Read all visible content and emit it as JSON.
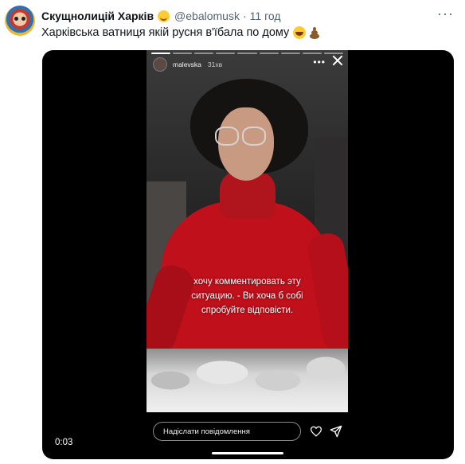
{
  "tweet": {
    "author_name": "Скущнолицій Харків",
    "handle": "@ebalomusk",
    "separator": "·",
    "time": "11 год",
    "text": "Харківська ватниця якій русня в'їбала по дому",
    "more_icon": "more-horizontal-icon",
    "emojis": [
      "smiling-face-icon",
      "grinning-squinting-face-icon",
      "pile-of-poo-icon"
    ]
  },
  "video": {
    "elapsed": "0:03",
    "story": {
      "username": "malevska",
      "posted_ago": "31хв",
      "caption_lines": [
        "хочу комментировать эту",
        "ситуацию. - Ви хоча б собі",
        "спробуйте відповісти."
      ],
      "reply_placeholder": "Надіслати повідомлення",
      "progress_segments": 9,
      "icons": [
        "more-horizontal-icon",
        "close-icon",
        "heart-icon",
        "send-icon"
      ]
    }
  },
  "colors": {
    "text": "#0f1419",
    "secondary_text": "#536471",
    "media_background": "#000000",
    "sweater_red": "#c0101c"
  }
}
